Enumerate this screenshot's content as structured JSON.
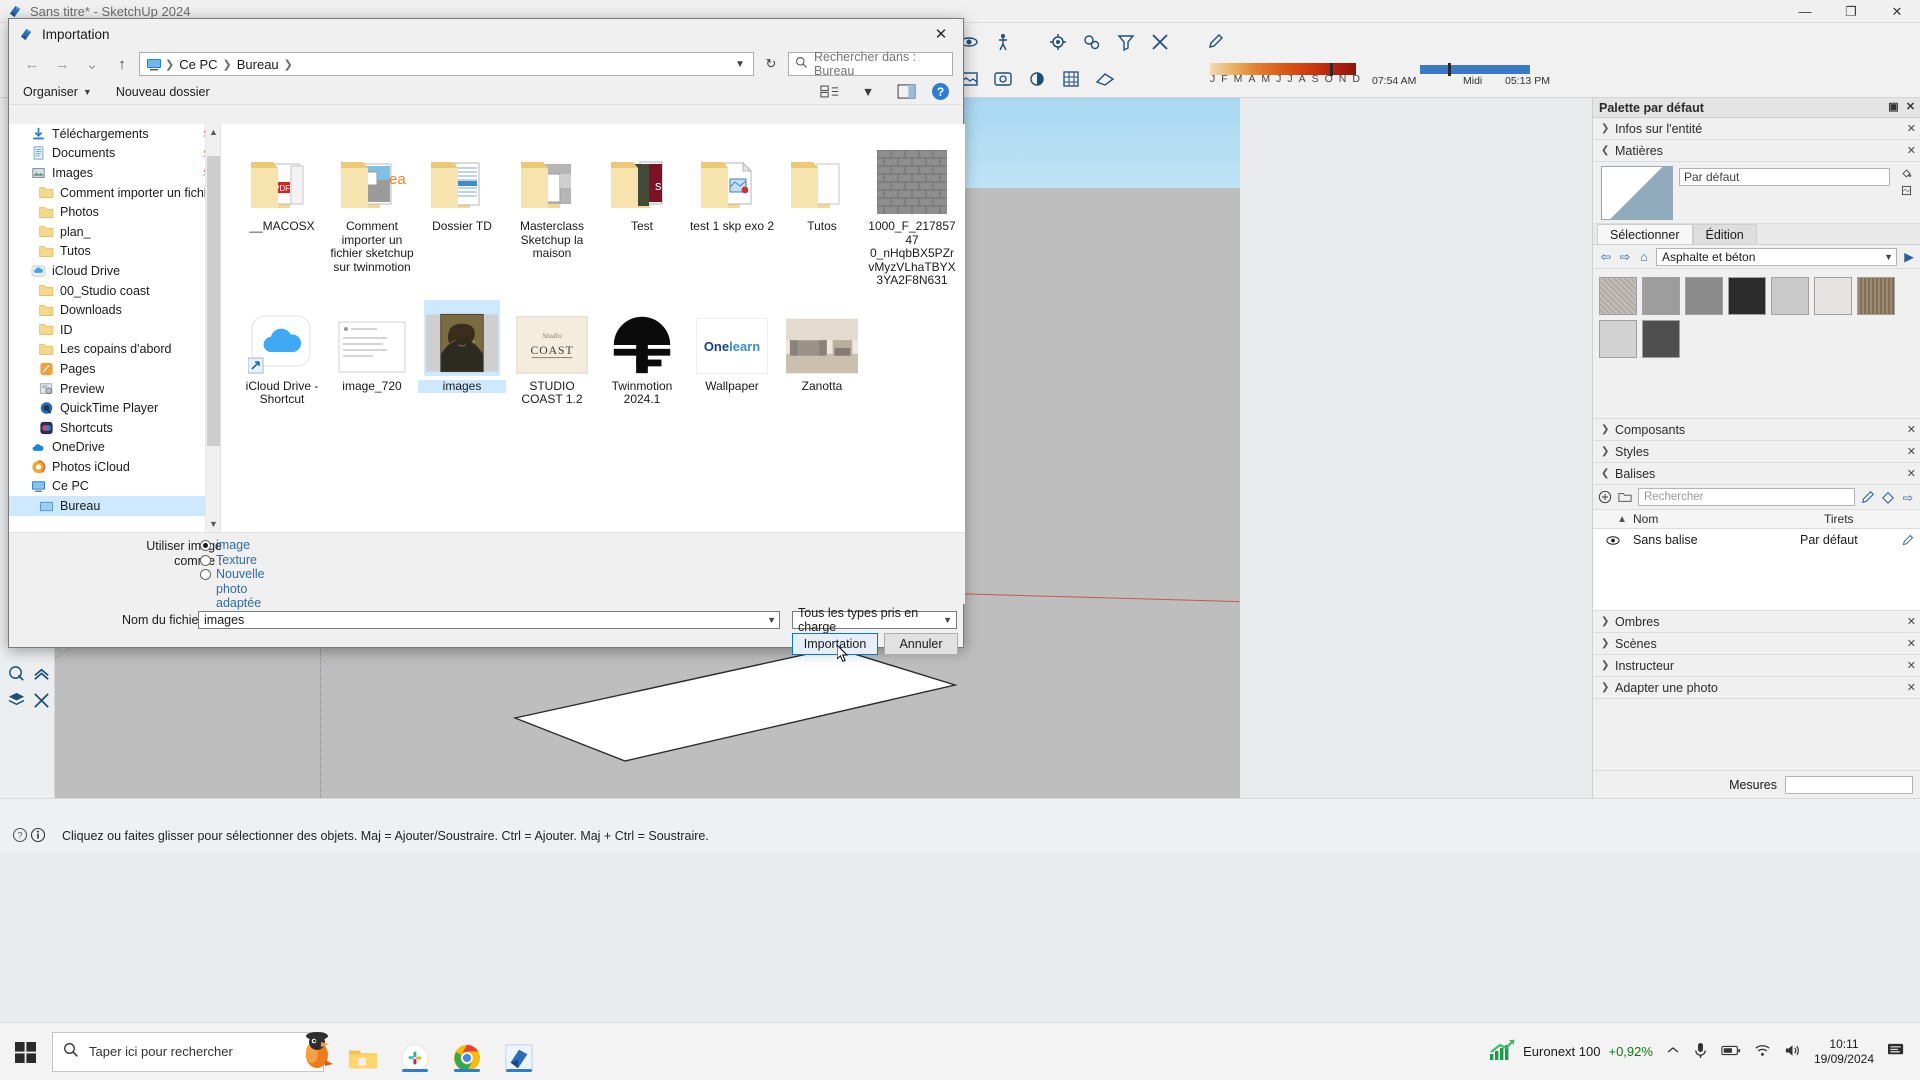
{
  "app": {
    "title": "Sans titre* - SketchUp 2024",
    "window_buttons": {
      "minimize": "—",
      "maximize": "❐",
      "close": "✕"
    },
    "logo_icon": "sketchup-logo-icon"
  },
  "sun_control": {
    "months": [
      "J",
      "F",
      "M",
      "A",
      "M",
      "J",
      "J",
      "A",
      "S",
      "O",
      "N",
      "D"
    ],
    "sunrise": "07:54 AM",
    "noon": "Midi",
    "sunset": "05:13 PM"
  },
  "status_bar": {
    "message": "Cliquez ou faites glisser pour sélectionner des objets. Maj = Ajouter/Soustraire. Ctrl = Ajouter. Maj + Ctrl = Soustraire.",
    "help_icon": "question-mark-icon",
    "info_icon": "info-icon"
  },
  "tray": {
    "title": "Palette par défaut",
    "sections": [
      {
        "label": "Infos sur l'entité",
        "expanded": false
      },
      {
        "label": "Matières",
        "expanded": true
      },
      {
        "label": "Composants",
        "expanded": false
      },
      {
        "label": "Styles",
        "expanded": false
      },
      {
        "label": "Balises",
        "expanded": true
      },
      {
        "label": "Ombres",
        "expanded": false
      },
      {
        "label": "Scènes",
        "expanded": false
      },
      {
        "label": "Instructeur",
        "expanded": false
      },
      {
        "label": "Adapter une photo",
        "expanded": false
      }
    ],
    "materials": {
      "name_value": "Par défaut",
      "tabs": [
        {
          "label": "Sélectionner",
          "active": true
        },
        {
          "label": "Édition",
          "active": false
        }
      ],
      "library": "Asphalte et béton",
      "swatch_colors": [
        "#b9b4ae",
        "#9a9a9a",
        "#777777",
        "#2e2e2e",
        "#c6c6c6",
        "#e2e0dc",
        "#8b7f6e",
        "#cfcfcf",
        "#4a4a4a"
      ]
    },
    "balises": {
      "search_placeholder": "Rechercher",
      "columns": [
        "Nom",
        "Tirets"
      ],
      "rows": [
        {
          "name": "Sans balise",
          "dashes": "Par défaut",
          "visible": true
        }
      ],
      "add_icon": "plus-circle-icon",
      "pencil_icon": "pencil-icon",
      "tag_icon": "tag-icon",
      "arrow_icon": "arrow-right-icon"
    },
    "mesures": {
      "label": "Mesures",
      "value": ""
    }
  },
  "dialog": {
    "title": "Importation",
    "close_label": "✕",
    "nav": {
      "back": "←",
      "forward": "→",
      "recent": "⌄",
      "up": "↑",
      "refresh": "↻",
      "breadcrumbs": [
        "Ce PC",
        "Bureau"
      ],
      "search_placeholder": "Rechercher dans : Bureau"
    },
    "commands": {
      "organize": "Organiser",
      "new_folder": "Nouveau dossier",
      "view_icon": "view-layout-icon",
      "pane_icon": "preview-pane-icon",
      "help": "?"
    },
    "nav_pane": [
      {
        "label": "Téléchargements",
        "icon": "download-icon",
        "level": 1,
        "pinned": true
      },
      {
        "label": "Documents",
        "icon": "documents-icon",
        "level": 1,
        "pinned": true
      },
      {
        "label": "Images",
        "icon": "pictures-icon",
        "level": 1,
        "pinned": true
      },
      {
        "label": "Comment importer un fichier sketchu",
        "icon": "folder-icon",
        "level": 2,
        "pinned": false
      },
      {
        "label": "Photos",
        "icon": "folder-icon",
        "level": 2,
        "pinned": false
      },
      {
        "label": "plan_",
        "icon": "folder-icon",
        "level": 2,
        "pinned": false
      },
      {
        "label": "Tutos",
        "icon": "folder-icon",
        "level": 2,
        "pinned": false
      },
      {
        "label": "iCloud Drive",
        "icon": "icloud-icon",
        "level": 1,
        "pinned": false
      },
      {
        "label": "00_Studio coast",
        "icon": "folder-icon",
        "level": 2,
        "pinned": false
      },
      {
        "label": "Downloads",
        "icon": "folder-icon",
        "level": 2,
        "pinned": false
      },
      {
        "label": "ID",
        "icon": "folder-icon",
        "level": 2,
        "pinned": false
      },
      {
        "label": "Les copains d'abord",
        "icon": "folder-icon",
        "level": 2,
        "pinned": false
      },
      {
        "label": "Pages",
        "icon": "pages-app-icon",
        "level": 2,
        "pinned": false
      },
      {
        "label": "Preview",
        "icon": "preview-app-icon",
        "level": 2,
        "pinned": false
      },
      {
        "label": "QuickTime Player",
        "icon": "quicktime-app-icon",
        "level": 2,
        "pinned": false
      },
      {
        "label": "Shortcuts",
        "icon": "shortcuts-app-icon",
        "level": 2,
        "pinned": false
      },
      {
        "label": "OneDrive",
        "icon": "onedrive-icon",
        "level": 1,
        "pinned": false
      },
      {
        "label": "Photos iCloud",
        "icon": "photos-icloud-icon",
        "level": 1,
        "pinned": false
      },
      {
        "label": "Ce PC",
        "icon": "computer-icon",
        "level": 1,
        "pinned": false
      },
      {
        "label": "Bureau",
        "icon": "desktop-icon",
        "level": 2,
        "pinned": false,
        "selected": true
      }
    ],
    "files": [
      {
        "name": "__MACOSX",
        "type": "folder-pdf",
        "selected": false
      },
      {
        "name": "Comment importer un fichier sketchup sur twinmotion",
        "type": "folder-image",
        "selected": false
      },
      {
        "name": "Dossier TD",
        "type": "folder-docs",
        "selected": false
      },
      {
        "name": "Masterclass Sketchup la maison",
        "type": "folder-gray",
        "selected": false
      },
      {
        "name": "Test",
        "type": "folder-book",
        "selected": false
      },
      {
        "name": "test 1 skp exo 2",
        "type": "folder-skp",
        "selected": false
      },
      {
        "name": "Tutos",
        "type": "folder-plain",
        "selected": false
      },
      {
        "name": "1000_F_21785747 0_nHqbBX5PZrvMyzVLhaTBYX3YA2F8N631",
        "type": "image-brick",
        "selected": false
      },
      {
        "name": "iCloud Drive - Shortcut",
        "type": "icloud-shortcut",
        "selected": false
      },
      {
        "name": "image_720",
        "type": "doc-white",
        "selected": false
      },
      {
        "name": "images",
        "type": "image-mona",
        "selected": true
      },
      {
        "name": "STUDIO COAST 1.2",
        "type": "image-coast",
        "selected": false
      },
      {
        "name": "Twinmotion 2024.1",
        "type": "image-twinmotion",
        "selected": false
      },
      {
        "name": "Wallpaper",
        "type": "image-onelearn",
        "selected": false
      },
      {
        "name": "Zanotta",
        "type": "image-sofa",
        "selected": false
      }
    ],
    "options": {
      "label": "Utiliser image comme :",
      "label_line1": "Utiliser image",
      "label_line2": "comme :",
      "choices": [
        {
          "label": "image",
          "selected": true
        },
        {
          "label": "Texture",
          "selected": false
        },
        {
          "label": "Nouvelle photo adaptée",
          "selected": false
        }
      ]
    },
    "footer": {
      "filename_label": "Nom du fichier :",
      "filename_value": "images",
      "filetype_value": "Tous les types pris en charge",
      "import_button": "Importation",
      "cancel_button": "Annuler"
    }
  },
  "taskbar": {
    "start_icon": "windows-start-icon",
    "search_placeholder": "Taper ici pour rechercher",
    "search_icon": "search-icon",
    "cortana_icon": "parrot-icon",
    "apps": [
      {
        "name": "file-explorer",
        "icon": "folder-icon",
        "active": false
      },
      {
        "name": "slack",
        "icon": "slack-icon",
        "active": true
      },
      {
        "name": "chrome",
        "icon": "chrome-icon",
        "active": true
      },
      {
        "name": "sketchup",
        "icon": "sketchup-logo-icon",
        "active": true
      }
    ],
    "tray": {
      "stock_label": "Euronext 100",
      "stock_change": "+0,92%",
      "chevron_icon": "chevron-up-icon",
      "mic_icon": "microphone-icon",
      "battery_icon": "battery-icon",
      "wifi_icon": "wifi-icon",
      "volume_icon": "volume-icon",
      "time": "10:11",
      "date": "19/09/2024",
      "notification_icon": "notifications-icon"
    }
  }
}
